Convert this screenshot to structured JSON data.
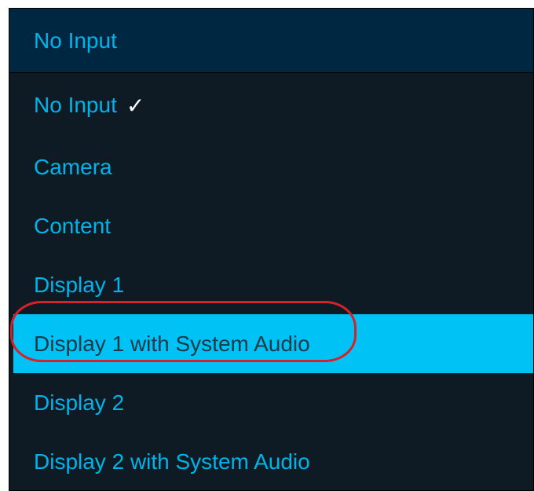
{
  "dropdown": {
    "selected_value": "No Input",
    "options": [
      {
        "label": "No Input",
        "checked": true,
        "check_icon": "checkmark-icon",
        "check_glyph": "✓"
      },
      {
        "label": "Camera"
      },
      {
        "label": "Content"
      },
      {
        "label": "Display 1"
      },
      {
        "label": "Display 1 with System Audio",
        "highlighted": true
      },
      {
        "label": "Display 2"
      },
      {
        "label": "Display 2 with System Audio"
      }
    ]
  },
  "colors": {
    "header_background": "#002742",
    "list_background": "#0e1b24",
    "accent_text": "#00b4ea",
    "highlight_background": "#00c2f4",
    "highlight_text": "#1a3a4a",
    "annotation": "#d8202a"
  }
}
